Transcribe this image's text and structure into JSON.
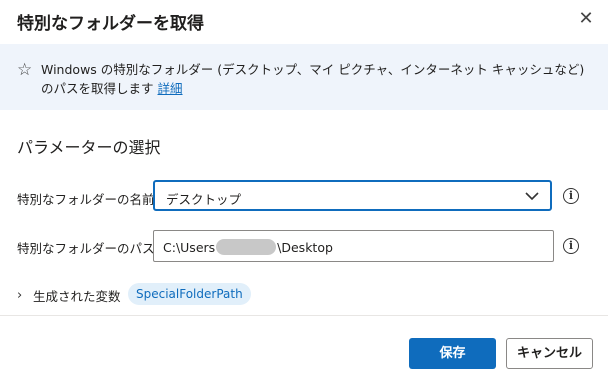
{
  "dialog": {
    "title": "特別なフォルダーを取得",
    "close_glyph": "✕"
  },
  "info": {
    "icon": "star-icon",
    "description": "Windows の特別なフォルダー (デスクトップ、マイ ピクチャ、インターネット キャッシュなど) のパスを取得します",
    "details_link": "詳細"
  },
  "params": {
    "section_title": "パラメーターの選択",
    "folder_name": {
      "label": "特別なフォルダーの名前:",
      "value": "デスクトップ"
    },
    "folder_path": {
      "label": "特別なフォルダーのパス:",
      "prefix": "C:\\Users",
      "suffix": "\\Desktop"
    }
  },
  "variables": {
    "label": "生成された変数",
    "name": "SpecialFolderPath"
  },
  "footer": {
    "save_label": "保存",
    "cancel_label": "キャンセル"
  },
  "colors": {
    "accent": "#0f6cbd",
    "banner_bg": "#eff4fb",
    "pill_bg": "#e1effa"
  }
}
